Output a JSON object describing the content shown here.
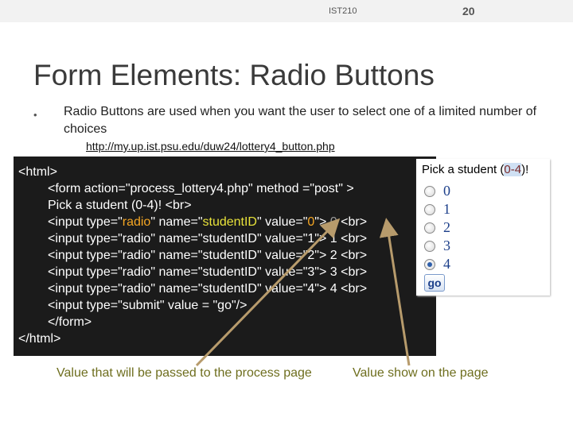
{
  "header": {
    "course": "IST210",
    "page_number": "20"
  },
  "title": "Form Elements: Radio Buttons",
  "bullet": {
    "marker": "•",
    "text": "Radio Buttons are used when you want the user to select one of a limited number of choices",
    "url": "http://my.up.ist.psu.edu/duw24/lottery4_button.php"
  },
  "code": {
    "l1": "<html>",
    "l2": "<form action=\"process_lottery4.php\" method =\"post\" >",
    "l3": "Pick a student (0-4)! <br>",
    "r_pre": "<input type=\"",
    "r_type": "radio",
    "r_mid1": "\" name=\"",
    "r_name": "studentID",
    "r_mid2": "\" value=\"",
    "v0": "0",
    "v1": "1",
    "v2": "2",
    "v3": "3",
    "v4": "4",
    "r_post": "\"> ",
    "br": " <br>",
    "l9": "<input type=\"submit\" value = \"go\"/>",
    "l10": "</form>",
    "l11": "</html>"
  },
  "preview": {
    "title_a": "Pick a student (",
    "title_b": "0-4",
    "title_c": ")!",
    "options": [
      "0",
      "1",
      "2",
      "3",
      "4"
    ],
    "selected": "4",
    "button": "go"
  },
  "captions": {
    "value_passed": "Value that will be passed to the process page",
    "value_shown": "Value show on the page"
  },
  "colors": {
    "arrow": "#b79b6c",
    "caption": "#6e6e1e",
    "code_bg": "#1b1b1b"
  }
}
